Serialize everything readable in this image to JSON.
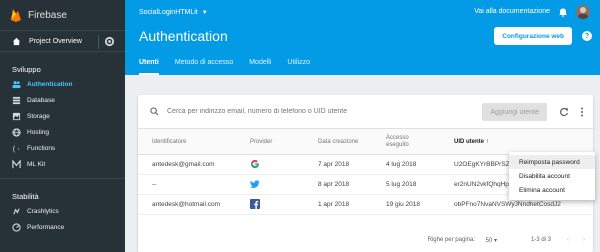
{
  "sidebar": {
    "brand": "Firebase",
    "overview": "Project Overview",
    "section1": "Sviluppo",
    "items": [
      {
        "label": "Authentication",
        "icon": "people-icon",
        "active": true
      },
      {
        "label": "Database",
        "icon": "database-icon"
      },
      {
        "label": "Storage",
        "icon": "storage-icon"
      },
      {
        "label": "Hosting",
        "icon": "globe-icon"
      },
      {
        "label": "Functions",
        "icon": "functions-icon"
      },
      {
        "label": "ML Kit",
        "icon": "mlkit-icon"
      }
    ],
    "section2": "Stabilità",
    "items2": [
      {
        "label": "Crashlytics",
        "icon": "crashlytics-icon"
      },
      {
        "label": "Performance",
        "icon": "performance-icon"
      }
    ]
  },
  "header": {
    "project": "SocialLoginHTMLit",
    "docs": "Vai alla documentazione",
    "title": "Authentication",
    "config_button": "Configurazione web",
    "tabs": [
      "Utenti",
      "Metodo di accesso",
      "Modelli",
      "Utilizzo"
    ]
  },
  "search": {
    "placeholder": "Cerca per indirizzo email, numero di telefono o UID utente",
    "add_user": "Aggiungi utente"
  },
  "table": {
    "headers": {
      "id": "Identificatore",
      "provider": "Provider",
      "created": "Data creazione",
      "access_line1": "Accesso",
      "access_line2": "eseguito",
      "uid": "UID utente ↑"
    },
    "rows": [
      {
        "id": "antedesk@gmail.com",
        "provider": "google",
        "created": "7 apr 2018",
        "access": "4 lug 2018",
        "uid": "U2OEgKYrBBPrSZK"
      },
      {
        "id": "--",
        "provider": "twitter",
        "created": "8 apr 2018",
        "access": "5 lug 2018",
        "uid": "er2nUN2vkfQhqHp"
      },
      {
        "id": "antedesk@hotmail.com",
        "provider": "facebook",
        "created": "1 apr 2018",
        "access": "19 giu 2018",
        "uid": "obPFno7NvaNVSWyJNndhetCosdJ2"
      }
    ]
  },
  "footer": {
    "rows_per_page": "Righe per pagina:",
    "rows_value": "50",
    "range": "1-3 di 3"
  },
  "menu": {
    "items": [
      "Reimposta password",
      "Disabilita account",
      "Elimina account"
    ]
  },
  "colors": {
    "sidebar": "#263238",
    "header": "#039be5",
    "active": "#4fc3f7"
  }
}
